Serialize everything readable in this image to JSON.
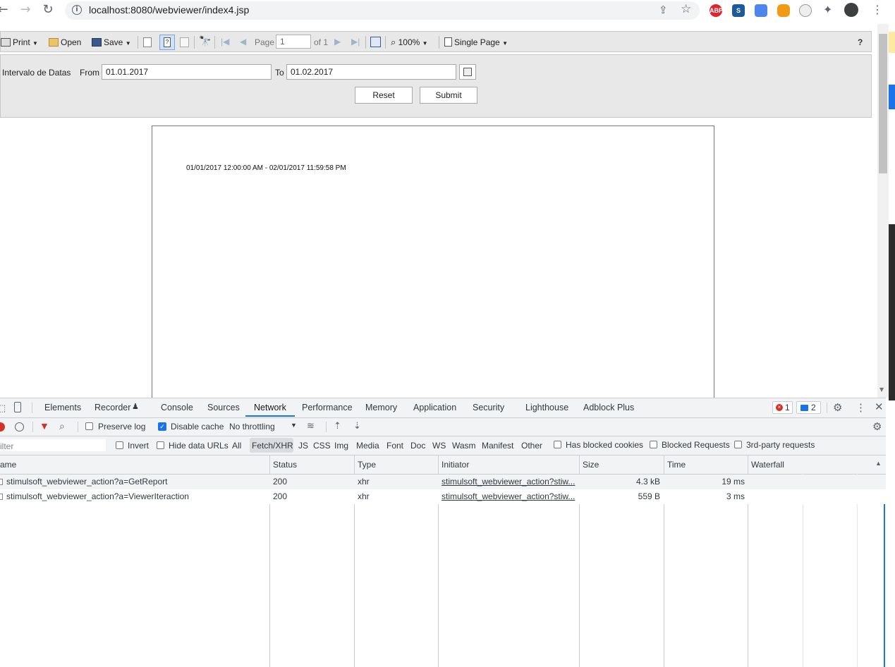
{
  "browser": {
    "url": "localhost:8080/webviewer/index4.jsp",
    "extensions": [
      "ABP",
      "S"
    ]
  },
  "toolbar": {
    "print_label": "Print",
    "open_label": "Open",
    "save_label": "Save",
    "page_label": "Page",
    "page_value": "1",
    "of_label": "of 1",
    "zoom_label": "100%",
    "view_mode_label": "Single Page",
    "help_label": "?"
  },
  "params": {
    "group_label": "Intervalo de Datas",
    "from_label": "From",
    "from_value": "01.01.2017",
    "to_label": "To",
    "to_value": "01.02.2017",
    "reset_label": "Reset",
    "submit_label": "Submit"
  },
  "report": {
    "date_range_text": "01/01/2017 12:00:00 AM - 02/01/2017 11:59:58 PM"
  },
  "devtools": {
    "tabs": [
      "Elements",
      "Recorder",
      "Console",
      "Sources",
      "Network",
      "Performance",
      "Memory",
      "Application",
      "Security",
      "Lighthouse",
      "Adblock Plus"
    ],
    "active_tab": "Network",
    "error_count": "1",
    "message_count": "2",
    "preserve_log_label": "Preserve log",
    "disable_cache_label": "Disable cache",
    "throttling_label": "No throttling",
    "filter_placeholder": "ilter",
    "invert_label": "Invert",
    "hide_data_urls_label": "Hide data URLs",
    "filter_types": [
      "All",
      "Fetch/XHR",
      "JS",
      "CSS",
      "Img",
      "Media",
      "Font",
      "Doc",
      "WS",
      "Wasm",
      "Manifest",
      "Other"
    ],
    "active_filter": "Fetch/XHR",
    "blocked_cookies_label": "Has blocked cookies",
    "blocked_requests_label": "Blocked Requests",
    "third_party_label": "3rd-party requests",
    "columns": [
      "ame",
      "Status",
      "Type",
      "Initiator",
      "Size",
      "Time",
      "Waterfall"
    ],
    "rows": [
      {
        "name": "stimulsoft_webviewer_action?a=GetReport",
        "status": "200",
        "type": "xhr",
        "initiator": "stimulsoft_webviewer_action?stiw...",
        "size": "4.3 kB",
        "time": "19 ms"
      },
      {
        "name": "stimulsoft_webviewer_action?a=ViewerIteraction",
        "status": "200",
        "type": "xhr",
        "initiator": "stimulsoft_webviewer_action?stiw...",
        "size": "559 B",
        "time": "3 ms"
      }
    ]
  },
  "colors": {
    "accent": "#1a73e8",
    "toolbar_bg": "#e8e8e8",
    "devtools_bg": "#f1f3f4",
    "error_red": "#d93025"
  }
}
